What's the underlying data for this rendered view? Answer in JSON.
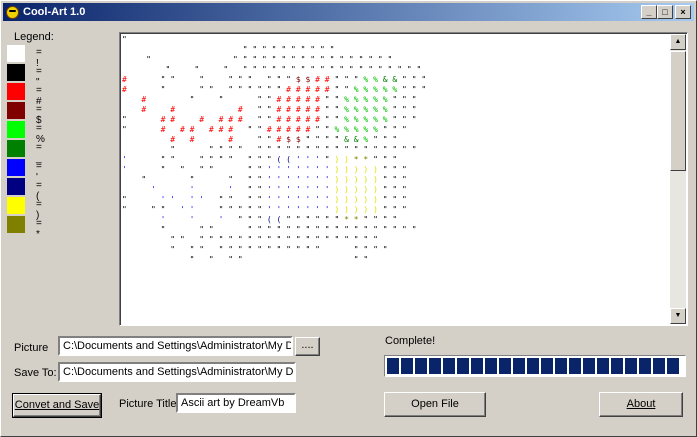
{
  "window": {
    "title": "Cool-Art 1.0",
    "min": "_",
    "max": "□",
    "close": "×"
  },
  "legend": {
    "title": "Legend:",
    "items": [
      {
        "color": "#ffffff",
        "label": "= !"
      },
      {
        "color": "#000000",
        "label": "= \""
      },
      {
        "color": "#ff0000",
        "label": "= #"
      },
      {
        "color": "#800000",
        "label": "= $"
      },
      {
        "color": "#00ff00",
        "label": "= %"
      },
      {
        "color": "#008000",
        "label": "= _"
      },
      {
        "color": "#0000ff",
        "label": "= '"
      },
      {
        "color": "#000080",
        "label": "= ("
      },
      {
        "color": "#ffff00",
        "label": "= )"
      },
      {
        "color": "#808000",
        "label": "= *"
      }
    ]
  },
  "art_lines": [
    "\"",
    "                         \" \" \" \" \" \" \" \" \" \"",
    "     \"                 \" \" \" \" \" \" \" \" \" \" \" \" \" \" \" \" \"",
    "         \"     \"     \"   \" \" \" \" \" \" \" \" \" \" \" \" \" \" \" \" \" \" \"",
    "#       \" \"     \"     \" \" \"   \" \" \" $ $ # # \" \" \" % % & & \" \" \"",
    "#       \"       \" \"   \" \" \" \" \" \" # # # # # \" \" % % % % % \" \" \"",
    "    #         \"     \"       \" \" # # # # # \" \" % % % % % \" \" \"",
    "    #     #             #   \" \" # # # # # \" \" % % % % % \" \" \"",
    "\"       # #     #   # # #   \" \" # # # # # \" \" % % % % % \" \" \"",
    "\"       #   # #   # # #   \" \" # # # # # \" \" % % % % % \" \" \"",
    "          #   #       #     \" \" # $ $ \" \" \" \" & & % \" \" \"",
    "          \"       \" \" \" \"   \" \" \" \" \" \" \" \" \" \" \" \" \" \" \" \" \"",
    "'       \" \"     \" \" \" \"   \" \" \" ( ( ' ' ' \" ) ) * * \" \" \"",
    "'       \"   \"   \" \"       \" \" ' ' ' ' ' ' ' ) ) ) ) ) \" \" \"",
    "    \"         \"       \"   \" \" ' ' ' ' ' ' ' ) ) ) ) ) \" \" \"",
    "      '       '       '   \" \" ' ' ' ' ' ' ' ) ) ) ) ) \" \" \"",
    "\"       ' '   ' '   \" \"   \" \" ' ' ' ' ' ' ' ) ) ) ) ) \" \" \"",
    "\"     \" \"   ' '     \" \" \" \" \" ' ' ' ' ' ' ' ) ) ) ) ) \" \" \"",
    "        '     '     '   \" \" \" ( ( \" \" \" \" \" \" * * \" \" \" \"",
    "        \"       \" \"       \" \" \" \" \" \" \" \" \" \" \" \" \" \" \" \" \" \"",
    "          \" \"   \" \" \" \" \" \" \" \" \" \" \" \" \" \" \" \" \" \" \"",
    "          \"   \" \"   \" \" \" \" \" \" \" \" \" \" \"       \" \" \" \"",
    "              \"   \"   \" \"                       \" \""
  ],
  "form": {
    "picture_label": "Picture",
    "picture_value": "C:\\Documents and Settings\\Administrator\\My Docu",
    "browse_label": "....",
    "saveto_label": "Save To:",
    "saveto_value": "C:\\Documents and Settings\\Administrator\\My Docu",
    "convert_label": "Convet and Save",
    "title_label": "Picture Title",
    "title_value": "Ascii art by DreamVb",
    "status": "Complete!",
    "progress_fraction": 1.0,
    "open_label": "Open File",
    "about_label": "About"
  }
}
